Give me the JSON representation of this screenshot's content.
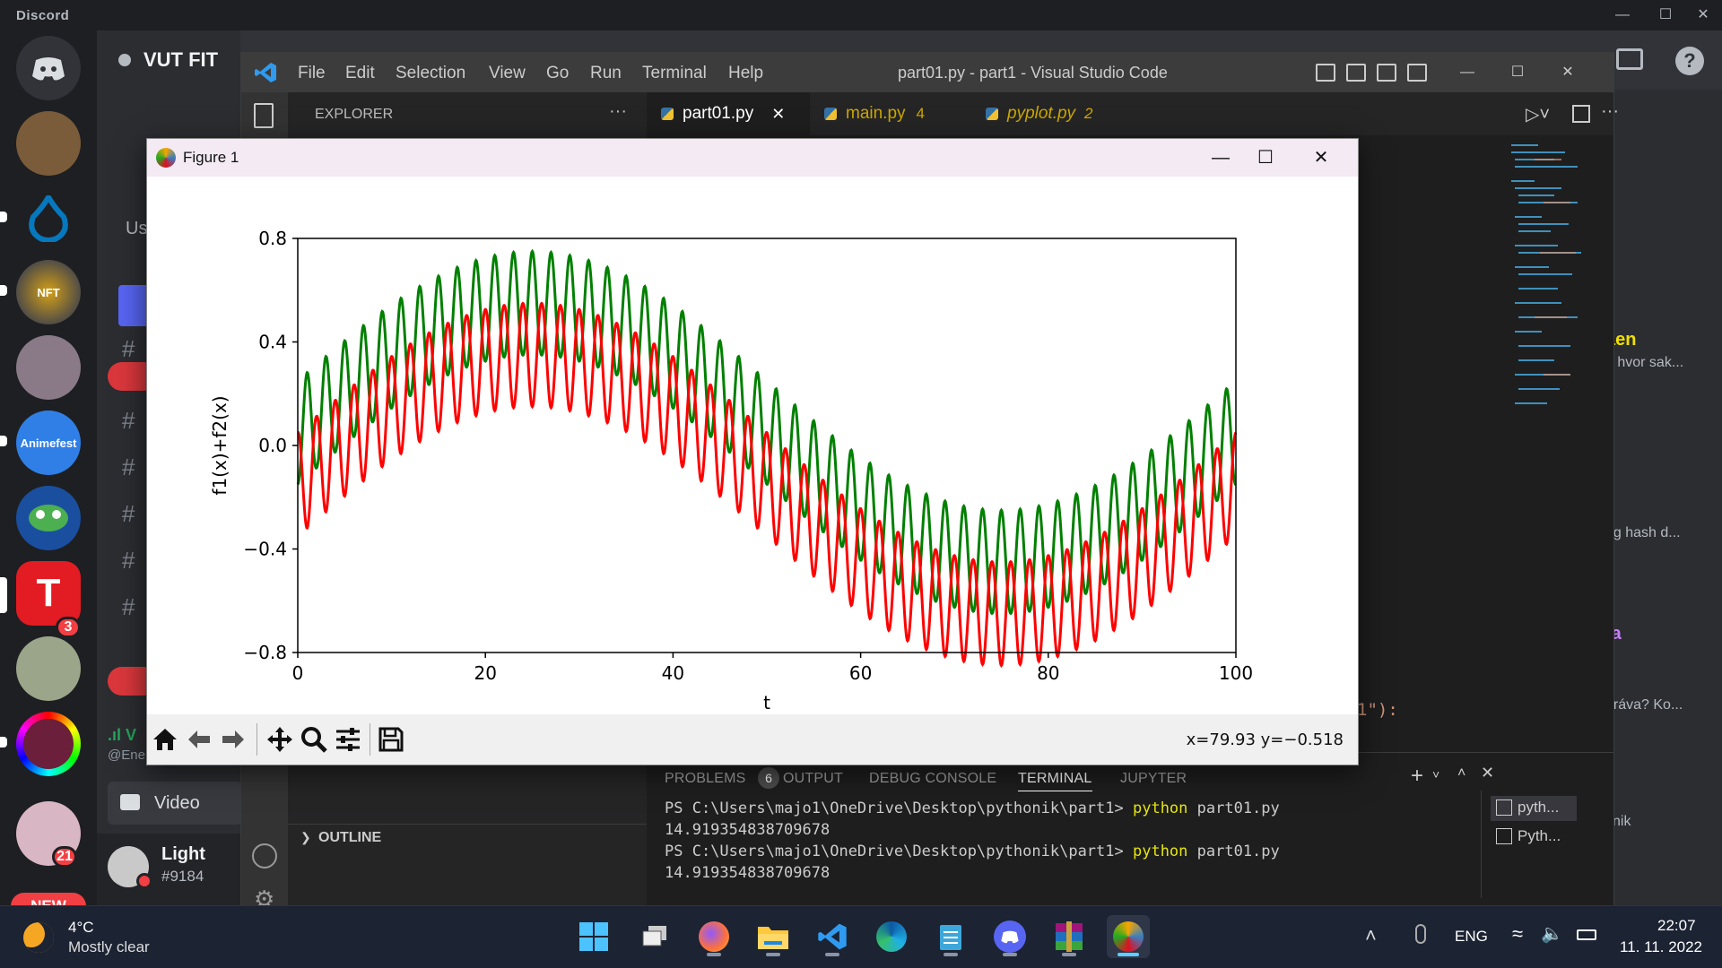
{
  "discord": {
    "brand": "Discord",
    "guild_name": "VUT FIT",
    "server_badges": [
      "3",
      "21"
    ],
    "new_badge": "NEW",
    "server_labels": [
      "Animefest"
    ],
    "channel_partial": "Us",
    "video_label": "Video",
    "user": {
      "name": "Light",
      "tag": "#9184",
      "handle_partial": "@Ene"
    },
    "right_snippets": [
      "aen",
      "e hvor sak...",
      "ng hash d...",
      "ta",
      "práva? Ko...",
      "ynik"
    ]
  },
  "vscode": {
    "menu": [
      "File",
      "Edit",
      "Selection",
      "View",
      "Go",
      "Run",
      "Terminal",
      "Help"
    ],
    "window_title": "part01.py - part1 - Visual Studio Code",
    "explorer_label": "EXPLORER",
    "explorer_more": "···",
    "tabs": [
      {
        "label": "part01.py",
        "badge": "",
        "color": "#ffffff",
        "close": "✕"
      },
      {
        "label": "main.py",
        "badge": "4",
        "color": "#cca700"
      },
      {
        "label": "pyplot.py",
        "badge": "2",
        "color": "#cca700"
      }
    ],
    "outline_label": "OUTLINE",
    "code_fragment": "1\"):",
    "panel_tabs": [
      "PROBLEMS",
      "OUTPUT",
      "DEBUG CONSOLE",
      "TERMINAL",
      "JUPYTER"
    ],
    "problems_count": "6",
    "terminal_lines": [
      {
        "prompt": "PS C:\\Users\\majo1\\OneDrive\\Desktop\\pythonik\\part1> ",
        "cmd": "python",
        "arg": " part01.py"
      },
      {
        "output": "14.919354838709678"
      },
      {
        "prompt": "PS C:\\Users\\majo1\\OneDrive\\Desktop\\pythonik\\part1> ",
        "cmd": "python",
        "arg": " part01.py"
      },
      {
        "output": "14.919354838709678"
      }
    ],
    "terminal_list": [
      "pyth...",
      "Pyth..."
    ]
  },
  "figure": {
    "window_title": "Figure 1",
    "coords_readout": "x=79.93 y=−0.518"
  },
  "chart_data": {
    "type": "line",
    "title": "",
    "xlabel": "t",
    "ylabel": "f1(x)+f2(x)",
    "xlim": [
      0,
      100
    ],
    "ylim": [
      -0.8,
      0.8
    ],
    "xticks": [
      "0",
      "20",
      "40",
      "60",
      "80",
      "100"
    ],
    "yticks": [
      "−0.8",
      "−0.4",
      "0.0",
      "0.4",
      "0.8"
    ],
    "series": [
      {
        "color": "#008000",
        "formula": "0.5*sin(2*pi*t/100) + 0.12 + 0.14*|sin(pi*t/2.17)|^0.5-like spikes",
        "x": [
          0,
          10,
          20,
          25,
          30,
          40,
          50,
          60,
          70,
          75,
          80,
          90,
          100
        ],
        "y_peaks": [
          0.27,
          0.52,
          0.7,
          0.75,
          0.72,
          0.58,
          0.3,
          0.0,
          -0.22,
          -0.25,
          -0.24,
          -0.1,
          0.2
        ]
      },
      {
        "color": "#ff0000",
        "x": [
          0,
          10,
          20,
          25,
          30,
          40,
          50,
          60,
          70,
          75,
          80,
          90,
          100
        ],
        "y_troughs": [
          -0.2,
          0.1,
          0.25,
          0.27,
          0.25,
          0.1,
          -0.2,
          -0.5,
          -0.7,
          -0.75,
          -0.72,
          -0.5,
          -0.05
        ]
      }
    ],
    "grid": false,
    "legend": "none"
  },
  "taskbar": {
    "weather_temp": "4°C",
    "weather_desc": "Mostly clear",
    "language": "ENG",
    "time": "22:07",
    "date": "11. 11. 2022"
  },
  "colors": {
    "discord_bg": "#1e1f22",
    "vscode_title": "#3c3c3c",
    "green_series": "#008000",
    "red_series": "#ff0000",
    "badge_red": "#f23f43"
  }
}
